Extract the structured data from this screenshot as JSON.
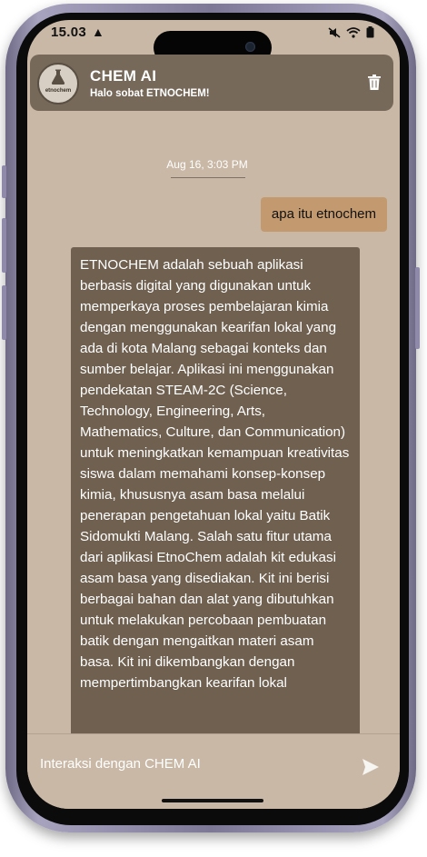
{
  "status_bar": {
    "time": "15.03"
  },
  "header": {
    "title": "CHEM AI",
    "subtitle": "Halo sobat ETNOCHEM!",
    "avatar_text": "etnochem"
  },
  "chat": {
    "timestamp": "Aug 16, 3:03 PM",
    "user_message": "apa itu etnochem",
    "bot_message": "ETNOCHEM adalah sebuah aplikasi berbasis digital yang digunakan untuk memperkaya proses pembelajaran kimia dengan menggunakan kearifan lokal yang ada di kota Malang sebagai konteks dan sumber belajar. Aplikasi ini menggunakan pendekatan STEAM-2C (Science, Technology, Engineering, Arts, Mathematics, Culture, dan Communication) untuk meningkatkan kemampuan kreativitas siswa dalam memahami konsep-konsep kimia, khususnya asam basa melalui penerapan pengetahuan lokal yaitu Batik Sidomukti Malang. Salah satu fitur utama dari aplikasi EtnoChem adalah kit edukasi asam basa yang disediakan. Kit ini berisi berbagai bahan dan alat yang dibutuhkan untuk melakukan percobaan pembuatan batik dengan mengaitkan materi asam basa. Kit ini dikembangkan dengan mempertimbangkan kearifan lokal"
  },
  "input": {
    "placeholder": "Interaksi dengan CHEM AI"
  },
  "icons": {
    "status_alert": "warning-icon",
    "status_right": [
      "mute-icon",
      "wifi-icon",
      "battery-icon"
    ],
    "header_right": "trash-icon",
    "send": "send-icon"
  },
  "colors": {
    "background": "#c9b8a6",
    "header": "#76695a",
    "user_bubble": "#c39a6f",
    "bot_bubble": "#6f6050"
  }
}
